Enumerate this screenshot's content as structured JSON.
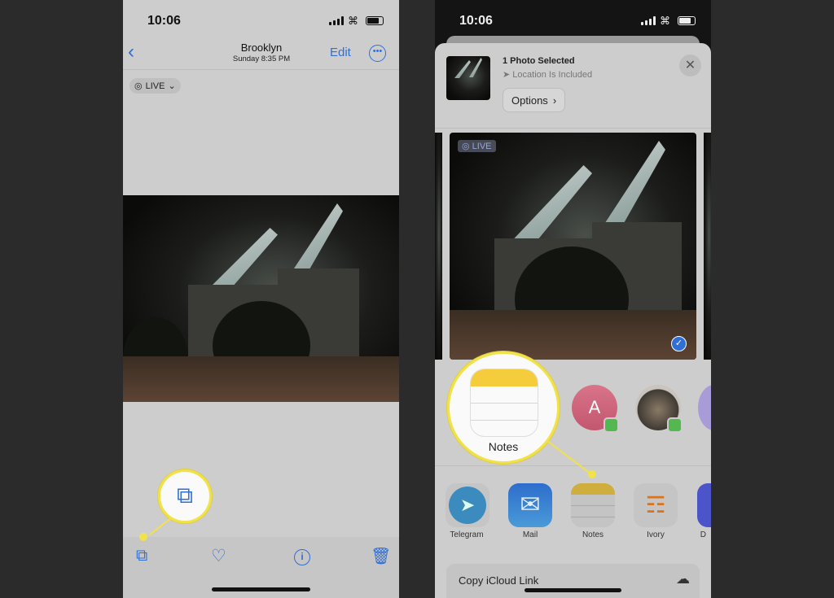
{
  "left_phone": {
    "status": {
      "time": "10:06"
    },
    "nav": {
      "back_icon": "chevron-left-icon",
      "title": "Brooklyn",
      "subtitle": "Sunday  8:35 PM",
      "edit_label": "Edit",
      "more_icon": "ellipsis-circle-icon"
    },
    "live_badge": {
      "label": "LIVE",
      "icon": "live-photo-icon"
    },
    "toolbar": {
      "share_icon": "share-icon",
      "favorite_icon": "heart-icon",
      "info_icon": "info-icon",
      "delete_icon": "trash-icon"
    },
    "highlight": {
      "icon": "share-icon",
      "color": "#f1e24a"
    }
  },
  "right_phone": {
    "status": {
      "time": "10:06"
    },
    "share_sheet": {
      "title": "1 Photo Selected",
      "subtitle": "Location Is Included",
      "location_icon": "location-arrow-icon",
      "options_label": "Options",
      "close_icon": "close-icon",
      "live_badge": "LIVE",
      "selected_icon": "checkmark-circle-icon",
      "people": [
        {
          "initial": "A",
          "badge": "messages-icon"
        },
        {
          "initial": "",
          "badge": "messages-icon"
        }
      ],
      "apps": [
        {
          "label": "Telegram"
        },
        {
          "label": "Mail"
        },
        {
          "label": "Notes"
        },
        {
          "label": "Ivory"
        },
        {
          "label": "D"
        }
      ],
      "action": {
        "label": "Copy iCloud Link",
        "icon": "cloud-link-icon"
      }
    },
    "highlight": {
      "label": "Notes",
      "color": "#f1e24a"
    }
  }
}
